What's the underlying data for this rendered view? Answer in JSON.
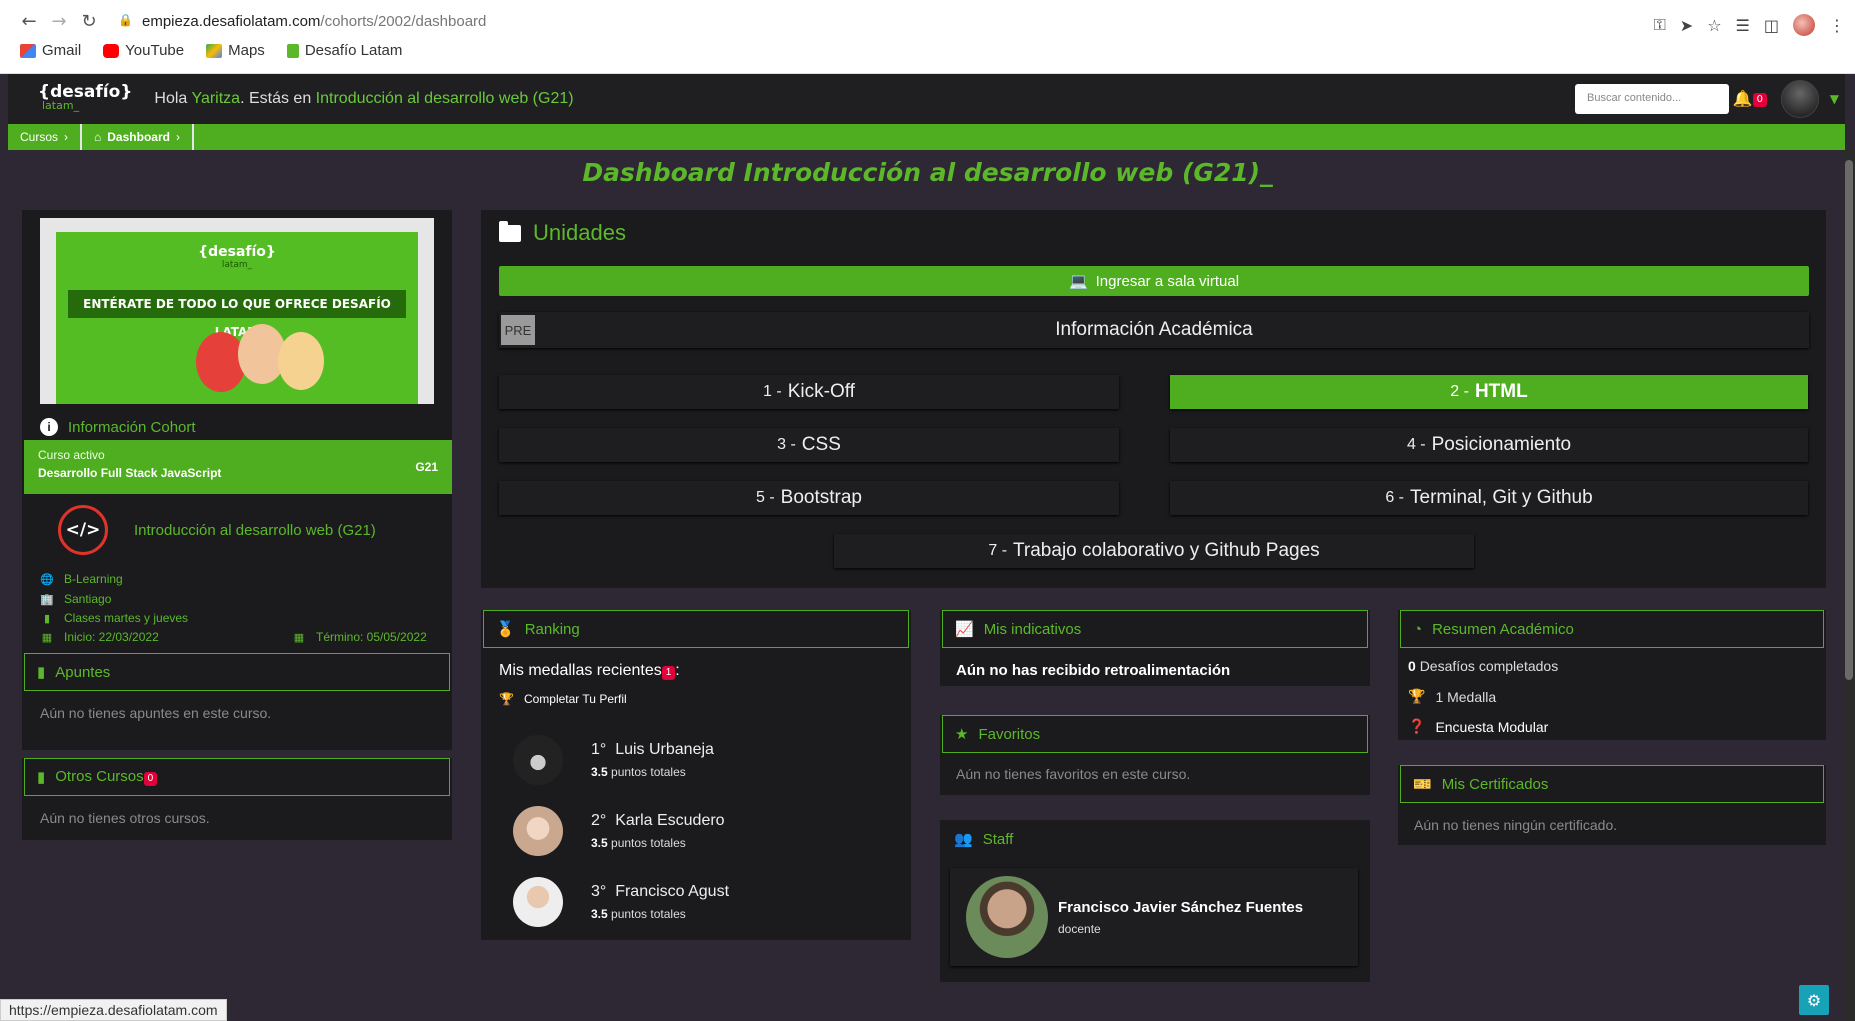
{
  "browser": {
    "url_host": "empieza.desafiolatam.com",
    "url_path": "/cohorts/2002/dashboard",
    "bookmarks": [
      "Gmail",
      "YouTube",
      "Maps",
      "Desafío Latam"
    ],
    "status_url": "https://empieza.desafiolatam.com"
  },
  "header": {
    "logo_top": "{desafío}",
    "logo_bottom": "latam_",
    "greeting_prefix": "Hola ",
    "user_name": "Yaritza",
    "greeting_mid": ". Estás en ",
    "course_link": "Introducción al desarrollo web (G21)",
    "search_placeholder": "Buscar contenido...",
    "notifications_count": "0"
  },
  "breadcrumbs": [
    "Cursos",
    "Dashboard"
  ],
  "page_title": "Dashboard Introducción al desarrollo web (G21)_",
  "left": {
    "banner_logo": "{desafío}",
    "banner_logo_sub": "latam_",
    "banner_text": "ENTÉRATE DE TODO LO QUE OFRECE DESAFÍO LATAM",
    "info_cohort_title": "Información Cohort",
    "curso_activo_label": "Curso activo",
    "curso_activo_value": "Desarrollo Full Stack JavaScript",
    "curso_activo_code": "G21",
    "course_name": "Introducción al desarrollo web (G21)",
    "modality": "B-Learning",
    "city": "Santiago",
    "schedule": "Clases martes y jueves",
    "start": "Inicio: 22/03/2022",
    "end": "Término: 05/05/2022",
    "apuntes_title": "Apuntes",
    "apuntes_empty": "Aún no tienes apuntes en este curso.",
    "otros_title": "Otros Cursos",
    "otros_count": "0",
    "otros_empty": "Aún no tienes otros cursos."
  },
  "unidades": {
    "title": "Unidades",
    "sala_label": "Ingresar a sala virtual",
    "pre_tag": "PRE",
    "info_academica": "Información Académica",
    "units": [
      {
        "num": "1 -",
        "label": "Kick-Off"
      },
      {
        "num": "2 -",
        "label": "HTML"
      },
      {
        "num": "3 -",
        "label": "CSS"
      },
      {
        "num": "4 -",
        "label": "Posicionamiento"
      },
      {
        "num": "5 -",
        "label": "Bootstrap"
      },
      {
        "num": "6 -",
        "label": "Terminal, Git y Github"
      },
      {
        "num": "7 -",
        "label": "Trabajo colaborativo y Github Pages"
      }
    ]
  },
  "ranking": {
    "title": "Ranking",
    "medals_label": "Mis medallas recientes",
    "medals_count": "1",
    "medals_colon": ":",
    "medal_item": "Completar Tu Perfil",
    "people": [
      {
        "pos": "1°",
        "name": "Luis Urbaneja",
        "points": "3.5",
        "points_label": "puntos totales"
      },
      {
        "pos": "2°",
        "name": "Karla Escudero",
        "points": "3.5",
        "points_label": "puntos totales"
      },
      {
        "pos": "3°",
        "name": "Francisco Agust",
        "points": "3.5",
        "points_label": "puntos totales"
      }
    ]
  },
  "indicativos": {
    "title": "Mis indicativos",
    "text": "Aún no has recibido retroalimentación"
  },
  "favoritos": {
    "title": "Favoritos",
    "text": "Aún no tienes favoritos en este curso."
  },
  "staff": {
    "title": "Staff",
    "name": "Francisco Javier Sánchez Fuentes",
    "role": "docente"
  },
  "resumen": {
    "title": "Resumen Académico",
    "challenges_count": "0",
    "challenges_label": "Desafíos completados",
    "medals": "1 Medalla",
    "survey": "Encuesta Modular"
  },
  "certificados": {
    "title": "Mis Certificados",
    "text": "Aún no tienes ningún certificado."
  },
  "colors": {
    "accent": "#5cb82a",
    "bar": "#4fae1f",
    "badge": "#e3003a",
    "background": "#2d2833",
    "card": "#1b1b1e"
  }
}
